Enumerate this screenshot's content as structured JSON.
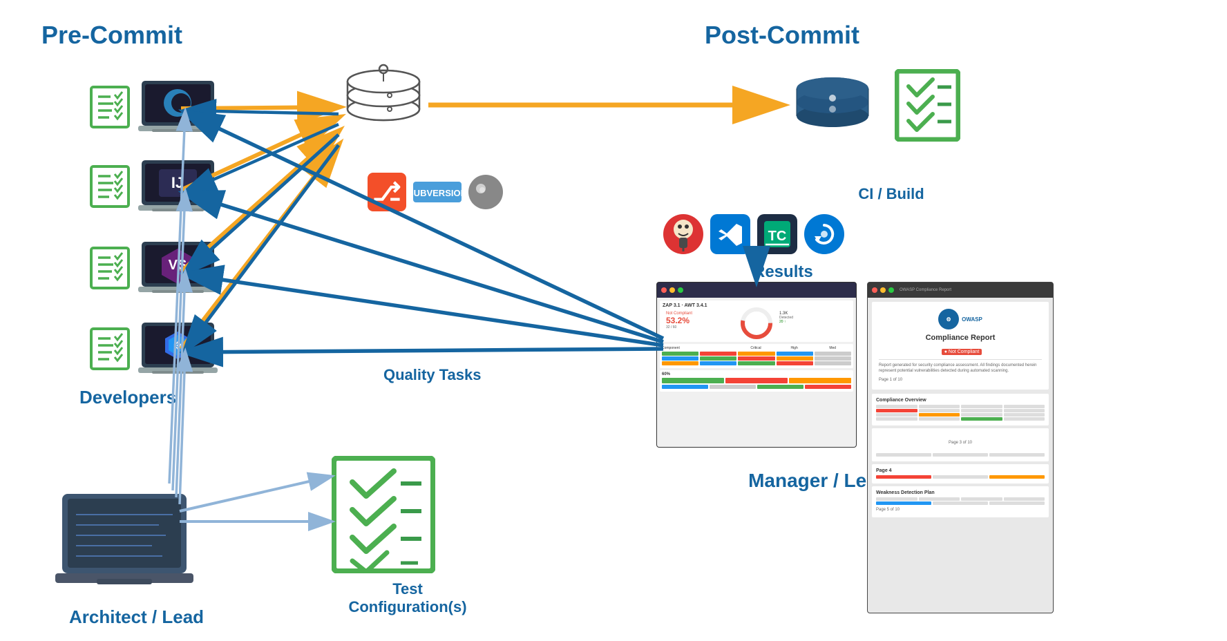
{
  "titles": {
    "pre_commit": "Pre-Commit",
    "post_commit": "Post-Commit",
    "ci_build": "CI / Build",
    "results": "Results",
    "manager_lead": "Manager / Lead",
    "developers": "Developers",
    "architect_lead": "Architect / Lead",
    "test_config": "Test Configuration(s)",
    "quality_tasks": "Quality Tasks"
  },
  "colors": {
    "blue_dark": "#1565a0",
    "orange": "#f5a623",
    "blue_arrow": "#1565a0",
    "blue_light": "#90b4d8",
    "green_border": "#4caf50"
  },
  "owasp": {
    "title": "Compliance Report",
    "status": "● Not Compliant",
    "section1": "Compliance Overview",
    "section2": "Weakness Detection Plan"
  }
}
